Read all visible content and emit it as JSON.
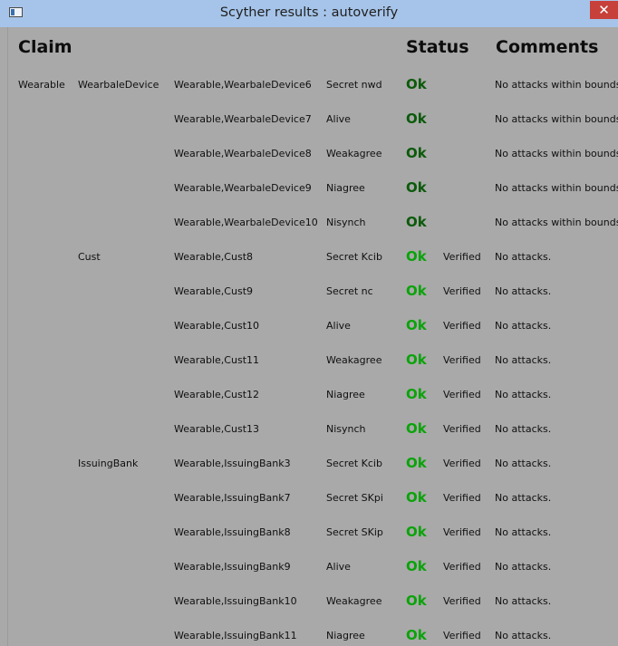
{
  "window": {
    "title": "Scyther results : autoverify",
    "close_glyph": "✕",
    "icon": "window-app-icon"
  },
  "headers": {
    "claim": "Claim",
    "status": "Status",
    "comments": "Comments"
  },
  "colors": {
    "ok_dark": "#0b5a0b",
    "ok_bright": "#0aa30a",
    "background": "#a9a9a9",
    "titlebar": "#a6c4e9",
    "close": "#c7403a"
  },
  "rows": [
    {
      "protocol": "Wearable",
      "role": "WearbaleDevice",
      "claim_id": "Wearable,WearbaleDevice6",
      "claim_type": "Secret nwd",
      "status": "Ok",
      "verified": "",
      "comment": "No attacks within bounds.",
      "tone": "dark"
    },
    {
      "protocol": "",
      "role": "",
      "claim_id": "Wearable,WearbaleDevice7",
      "claim_type": "Alive",
      "status": "Ok",
      "verified": "",
      "comment": "No attacks within bounds.",
      "tone": "dark"
    },
    {
      "protocol": "",
      "role": "",
      "claim_id": "Wearable,WearbaleDevice8",
      "claim_type": "Weakagree",
      "status": "Ok",
      "verified": "",
      "comment": "No attacks within bounds.",
      "tone": "dark"
    },
    {
      "protocol": "",
      "role": "",
      "claim_id": "Wearable,WearbaleDevice9",
      "claim_type": "Niagree",
      "status": "Ok",
      "verified": "",
      "comment": "No attacks within bounds.",
      "tone": "dark"
    },
    {
      "protocol": "",
      "role": "",
      "claim_id": "Wearable,WearbaleDevice10",
      "claim_type": "Nisynch",
      "status": "Ok",
      "verified": "",
      "comment": "No attacks within bounds.",
      "tone": "dark"
    },
    {
      "protocol": "",
      "role": "Cust",
      "claim_id": "Wearable,Cust8",
      "claim_type": "Secret Kcib",
      "status": "Ok",
      "verified": "Verified",
      "comment": "No attacks.",
      "tone": "bright"
    },
    {
      "protocol": "",
      "role": "",
      "claim_id": "Wearable,Cust9",
      "claim_type": "Secret nc",
      "status": "Ok",
      "verified": "Verified",
      "comment": "No attacks.",
      "tone": "bright"
    },
    {
      "protocol": "",
      "role": "",
      "claim_id": "Wearable,Cust10",
      "claim_type": "Alive",
      "status": "Ok",
      "verified": "Verified",
      "comment": "No attacks.",
      "tone": "bright"
    },
    {
      "protocol": "",
      "role": "",
      "claim_id": "Wearable,Cust11",
      "claim_type": "Weakagree",
      "status": "Ok",
      "verified": "Verified",
      "comment": "No attacks.",
      "tone": "bright"
    },
    {
      "protocol": "",
      "role": "",
      "claim_id": "Wearable,Cust12",
      "claim_type": "Niagree",
      "status": "Ok",
      "verified": "Verified",
      "comment": "No attacks.",
      "tone": "bright"
    },
    {
      "protocol": "",
      "role": "",
      "claim_id": "Wearable,Cust13",
      "claim_type": "Nisynch",
      "status": "Ok",
      "verified": "Verified",
      "comment": "No attacks.",
      "tone": "bright"
    },
    {
      "protocol": "",
      "role": "IssuingBank",
      "claim_id": "Wearable,IssuingBank3",
      "claim_type": "Secret Kcib",
      "status": "Ok",
      "verified": "Verified",
      "comment": "No attacks.",
      "tone": "bright"
    },
    {
      "protocol": "",
      "role": "",
      "claim_id": "Wearable,IssuingBank7",
      "claim_type": "Secret SKpi",
      "status": "Ok",
      "verified": "Verified",
      "comment": "No attacks.",
      "tone": "bright"
    },
    {
      "protocol": "",
      "role": "",
      "claim_id": "Wearable,IssuingBank8",
      "claim_type": "Secret SKip",
      "status": "Ok",
      "verified": "Verified",
      "comment": "No attacks.",
      "tone": "bright"
    },
    {
      "protocol": "",
      "role": "",
      "claim_id": "Wearable,IssuingBank9",
      "claim_type": "Alive",
      "status": "Ok",
      "verified": "Verified",
      "comment": "No attacks.",
      "tone": "bright"
    },
    {
      "protocol": "",
      "role": "",
      "claim_id": "Wearable,IssuingBank10",
      "claim_type": "Weakagree",
      "status": "Ok",
      "verified": "Verified",
      "comment": "No attacks.",
      "tone": "bright"
    },
    {
      "protocol": "",
      "role": "",
      "claim_id": "Wearable,IssuingBank11",
      "claim_type": "Niagree",
      "status": "Ok",
      "verified": "Verified",
      "comment": "No attacks.",
      "tone": "bright"
    }
  ]
}
